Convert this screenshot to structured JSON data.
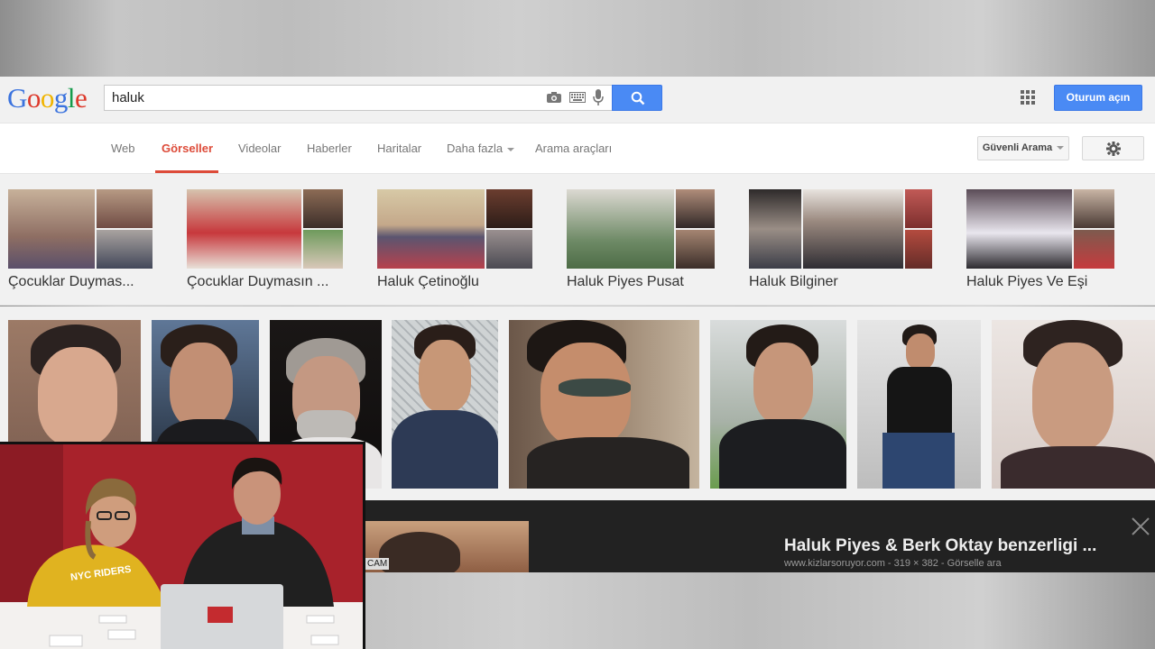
{
  "google": {
    "logo": [
      "G",
      "o",
      "o",
      "g",
      "l",
      "e"
    ],
    "search_value": "haluk",
    "signin_label": "Oturum açın"
  },
  "nav": {
    "items": [
      "Web",
      "Görseller",
      "Videolar",
      "Haberler",
      "Haritalar",
      "Daha fazla",
      "Arama araçları"
    ],
    "active": "Görseller",
    "safe_search": "Güvenli Arama"
  },
  "suggestions": [
    "Çocuklar Duymas...",
    "Çocuklar Duymasın ...",
    "Haluk Çetinoğlu",
    "Haluk Piyes Pusat",
    "Haluk Bilginer",
    "Haluk Piyes Ve Eşi"
  ],
  "preview": {
    "title": "Haluk Piyes & Berk Oktay benzerligi ...",
    "meta": "www.kizlarsoruyor.com - 319 × 382 - Görselle ara",
    "close_icon": "close-icon",
    "thumb_caption": "CAM"
  },
  "webcam": {
    "sweatshirt_text": "NYC RIDERS"
  },
  "colors": {
    "accent": "#4a8af4",
    "active_tab": "#dd4b39",
    "webcam_wall": "#a8222b"
  }
}
